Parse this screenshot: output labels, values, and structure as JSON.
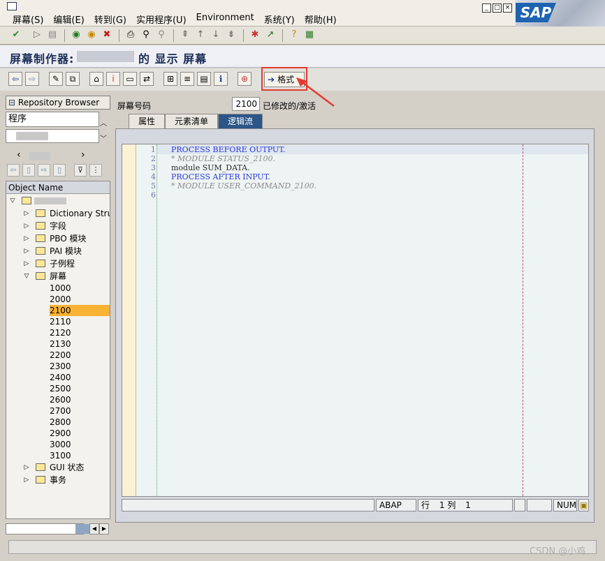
{
  "menu": {
    "items": [
      "屏幕(S)",
      "编辑(E)",
      "转到(G)",
      "实用程序(U)",
      "Environment",
      "系统(Y)",
      "帮助(H)"
    ]
  },
  "logo": "SAP",
  "screen_title": {
    "prefix": "屏幕制作器:",
    "suffix": "的 显示 屏幕"
  },
  "app_toolbar": {
    "format_label": "格式"
  },
  "left": {
    "repo_browser_label": "Repository Browser",
    "object_type": "程序",
    "tree_header": "Object Name",
    "nodes": [
      {
        "label": "Dictionary Struc"
      },
      {
        "label": "字段"
      },
      {
        "label": "PBO 模块"
      },
      {
        "label": "PAI 模块"
      },
      {
        "label": "子例程"
      },
      {
        "label": "屏幕"
      }
    ],
    "screens": [
      "1000",
      "2000",
      "2100",
      "2110",
      "2120",
      "2130",
      "2200",
      "2300",
      "2400",
      "2500",
      "2600",
      "2700",
      "2800",
      "2900",
      "3000",
      "3100"
    ],
    "selected_screen": "2100",
    "tail_nodes": [
      {
        "label": "GUI 状态"
      },
      {
        "label": "事务"
      }
    ]
  },
  "main": {
    "screen_number_label": "屏幕号码",
    "screen_number": "2100",
    "screen_status": "已修改的/激活",
    "tabs": [
      {
        "label": "属性",
        "active": false
      },
      {
        "label": "元素清单",
        "active": false
      },
      {
        "label": "逻辑流",
        "active": true
      }
    ],
    "code_lines": [
      {
        "no": "1",
        "text": "PROCESS BEFORE OUTPUT.",
        "kind": "kw"
      },
      {
        "no": "2",
        "text": "* MODULE STATUS_2100.",
        "kind": "cm"
      },
      {
        "no": "3",
        "text": "module SUM_DATA.",
        "kind": "tx"
      },
      {
        "no": "4",
        "text": "PROCESS AFTER INPUT.",
        "kind": "kw"
      },
      {
        "no": "5",
        "text": "* MODULE USER_COMMAND_2100.",
        "kind": "cm"
      },
      {
        "no": "6",
        "text": "",
        "kind": "tx"
      }
    ],
    "editor_status": {
      "language": "ABAP",
      "row_label": "行",
      "row": "1",
      "col_label": "列",
      "col": "1",
      "num": "NUM"
    }
  },
  "watermark": "CSDN @小鸡",
  "colors": {
    "active_tab": "#2c5687",
    "selected_row": "#f9b233",
    "highlight_box": "#e43a2e",
    "keyword": "#2a3ad8"
  }
}
